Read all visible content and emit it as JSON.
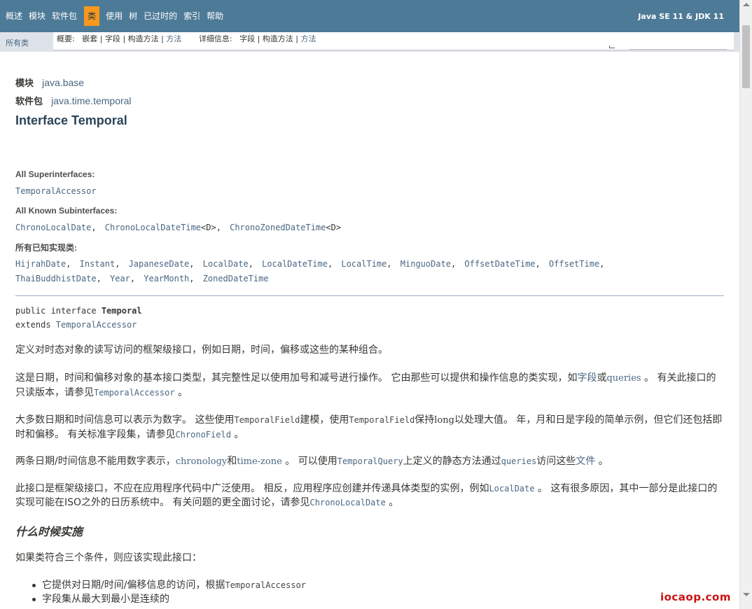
{
  "topnav": {
    "items": [
      "概述",
      "模块",
      "软件包",
      "类",
      "使用",
      "树",
      "已过时的",
      "索引",
      "帮助"
    ],
    "active_index": 3,
    "about": "Java SE 11 & JDK 11"
  },
  "subnav": {
    "all_classes": "所有类",
    "summary_label": "概要:",
    "summary_nested": "嵌套",
    "summary_field": "字段",
    "summary_constr": "构造方法",
    "summary_method": "方法",
    "detail_label": "详细信息:",
    "detail_field": "字段",
    "detail_constr": "构造方法",
    "detail_method": "方法",
    "sep": "|"
  },
  "header": {
    "module_label": "模块",
    "module_value": "java.base",
    "package_label": "软件包",
    "package_value": "java.time.temporal",
    "title": "Interface Temporal"
  },
  "superinterfaces": {
    "label": "All Superinterfaces:",
    "items": [
      "TemporalAccessor"
    ]
  },
  "subinterfaces": {
    "label": "All Known Subinterfaces:",
    "items": [
      "ChronoLocalDate",
      "ChronoLocalDateTime",
      "ChronoZonedDateTime"
    ],
    "generic_suffix": "<D>"
  },
  "implementing": {
    "label": "所有已知实现类:",
    "row1": [
      "HijrahDate",
      "Instant",
      "JapaneseDate",
      "LocalDate",
      "LocalDateTime",
      "LocalTime",
      "MinguoDate",
      "OffsetDateTime",
      "OffsetTime"
    ],
    "row2": [
      "ThaiBuddhistDate",
      "Year",
      "YearMonth",
      "ZonedDateTime"
    ],
    "comma": ","
  },
  "declaration": {
    "line1_prefix": "public interface ",
    "line1_name": "Temporal",
    "line2_prefix": "extends ",
    "line2_link": "TemporalAccessor"
  },
  "description": {
    "p1": "定义对时态对象的读写访问的框架级接口，例如日期，时间，偏移或这些的某种组合。",
    "p2_a": "这是日期，时间和偏移对象的基本接口类型，其完整性足以使用加号和减号进行操作。 它由那些可以提供和操作信息的类实现，如",
    "p2_link1": "字段",
    "p2_b": "或",
    "p2_link2": "queries",
    "p2_c": " 。 有关此接口的只读版本，请参见",
    "p2_code": "TemporalAccessor",
    "p2_d": " 。",
    "p3_a": "大多数日期和时间信息可以表示为数字。 这些使用",
    "p3_code1": "TemporalField",
    "p3_b": "建模，使用",
    "p3_code2": "TemporalField",
    "p3_c": "保持",
    "p3_long": "long",
    "p3_d": "以处理大值。 年，月和日是字段的简单示例，但它们还包括即时和偏移。 有关标准字段集，请参见",
    "p3_code3": "ChronoField",
    "p3_e": " 。",
    "p4_a": "两条日期/时间信息不能用数字表示，",
    "p4_link1": "chronology",
    "p4_b": "和",
    "p4_link2": "time-zone",
    "p4_c": " 。 可以使用",
    "p4_code1": "TemporalQuery",
    "p4_d": "上定义的静态方法通过",
    "p4_code2": "queries",
    "p4_e": "访问这些",
    "p4_link3": "文件",
    "p4_f": " 。",
    "p5_a": "此接口是框架级接口，不应在应用程序代码中广泛使用。 相反，应用程序应创建并传递具体类型的实例，例如",
    "p5_code1": "LocalDate",
    "p5_b": " 。 这有很多原因，其中一部分是此接口的实现可能在ISO之外的日历系统中。 有关问题的更全面讨论，请参见",
    "p5_code2": "ChronoLocalDate",
    "p5_c": " 。"
  },
  "when_to_implement": {
    "heading": "什么时候实施",
    "intro": "如果类符合三个条件，则应该实现此接口：",
    "item1_text": "它提供对日期/时间/偏移信息的访问，根据",
    "item1_code": "TemporalAccessor",
    "item2_text": "字段集从最大到最小是连续的"
  },
  "watermark": "iocaop.com"
}
